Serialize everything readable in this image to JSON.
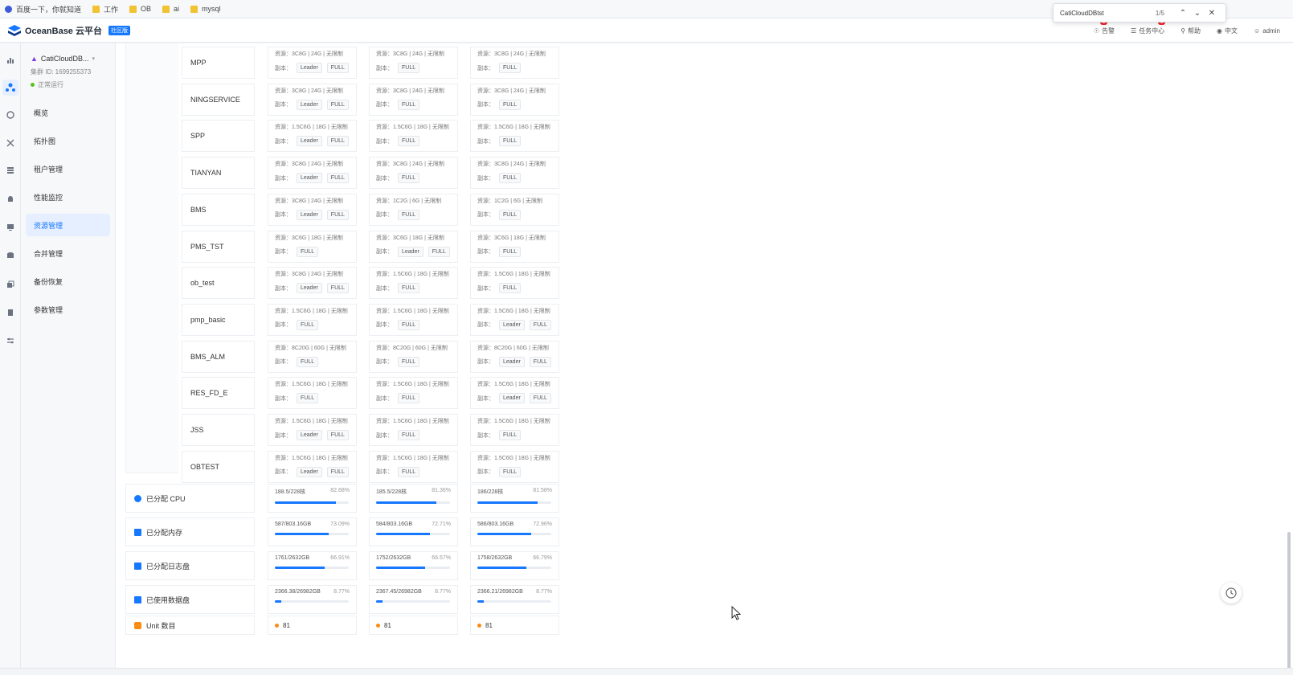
{
  "bookmarks": [
    "百度一下，你就知道",
    "工作",
    "OB",
    "ai",
    "mysql"
  ],
  "find": {
    "text": "CatiCloudDBtst",
    "count": "1/5"
  },
  "header": {
    "logo": "OceanBase 云平台",
    "badge": "社区版",
    "items": [
      {
        "label": "告警",
        "badge": "1"
      },
      {
        "label": "任务中心",
        "badge": "1"
      },
      {
        "label": "帮助"
      },
      {
        "label": "中文"
      },
      {
        "label": "admin"
      }
    ]
  },
  "cluster": {
    "name": "CatiCloudDB...",
    "id": "集群 ID: 1699255373",
    "status": "正常运行"
  },
  "menu": [
    "概览",
    "拓扑图",
    "租户管理",
    "性能监控",
    "资源管理",
    "合并管理",
    "备份恢复",
    "参数管理"
  ],
  "rows": [
    {
      "name": "MPP",
      "cells": [
        {
          "res": "资源：3C8G | 24G | 无限制",
          "reps": [
            "Leader",
            "FULL"
          ]
        },
        {
          "res": "资源：3C8G | 24G | 无限制",
          "reps": [
            "FULL"
          ]
        },
        {
          "res": "资源：3C8G | 24G | 无限制",
          "reps": [
            "FULL"
          ]
        }
      ]
    },
    {
      "name": "NINGSERVICE",
      "cells": [
        {
          "res": "资源：3C8G | 24G | 无限制",
          "reps": [
            "Leader",
            "FULL"
          ]
        },
        {
          "res": "资源：3C8G | 24G | 无限制",
          "reps": [
            "FULL"
          ]
        },
        {
          "res": "资源：3C8G | 24G | 无限制",
          "reps": [
            "FULL"
          ]
        }
      ]
    },
    {
      "name": "SPP",
      "cells": [
        {
          "res": "资源：1.5C6G | 18G | 无限制",
          "reps": [
            "Leader",
            "FULL"
          ]
        },
        {
          "res": "资源：1.5C6G | 18G | 无限制",
          "reps": [
            "FULL"
          ]
        },
        {
          "res": "资源：1.5C6G | 18G | 无限制",
          "reps": [
            "FULL"
          ]
        }
      ]
    },
    {
      "name": "TIANYAN",
      "cells": [
        {
          "res": "资源：3C8G | 24G | 无限制",
          "reps": [
            "Leader",
            "FULL"
          ]
        },
        {
          "res": "资源：3C8G | 24G | 无限制",
          "reps": [
            "FULL"
          ]
        },
        {
          "res": "资源：3C8G | 24G | 无限制",
          "reps": [
            "FULL"
          ]
        }
      ]
    },
    {
      "name": "BMS",
      "cells": [
        {
          "res": "资源：3C8G | 24G | 无限制",
          "reps": [
            "Leader",
            "FULL"
          ]
        },
        {
          "res": "资源：1C2G | 6G | 无限制",
          "reps": [
            "FULL"
          ]
        },
        {
          "res": "资源：1C2G | 6G | 无限制",
          "reps": [
            "FULL"
          ]
        }
      ]
    },
    {
      "name": "PMS_TST",
      "cells": [
        {
          "res": "资源：3C6G | 18G | 无限制",
          "reps": [
            "FULL"
          ]
        },
        {
          "res": "资源：3C6G | 18G | 无限制",
          "reps": [
            "Leader",
            "FULL"
          ]
        },
        {
          "res": "资源：3C6G | 18G | 无限制",
          "reps": [
            "FULL"
          ]
        }
      ]
    },
    {
      "name": "ob_test",
      "cells": [
        {
          "res": "资源：3C8G | 24G | 无限制",
          "reps": [
            "Leader",
            "FULL"
          ]
        },
        {
          "res": "资源：1.5C6G | 18G | 无限制",
          "reps": [
            "FULL"
          ]
        },
        {
          "res": "资源：1.5C6G | 18G | 无限制",
          "reps": [
            "FULL"
          ]
        }
      ]
    },
    {
      "name": "pmp_basic",
      "cells": [
        {
          "res": "资源：1.5C6G | 18G | 无限制",
          "reps": [
            "FULL"
          ]
        },
        {
          "res": "资源：1.5C6G | 18G | 无限制",
          "reps": [
            "FULL"
          ]
        },
        {
          "res": "资源：1.5C6G | 18G | 无限制",
          "reps": [
            "Leader",
            "FULL"
          ]
        }
      ]
    },
    {
      "name": "BMS_ALM",
      "cells": [
        {
          "res": "资源：8C20G | 60G | 无限制",
          "reps": [
            "FULL"
          ]
        },
        {
          "res": "资源：8C20G | 60G | 无限制",
          "reps": [
            "FULL"
          ]
        },
        {
          "res": "资源：8C20G | 60G | 无限制",
          "reps": [
            "Leader",
            "FULL"
          ]
        }
      ]
    },
    {
      "name": "RES_FD_E",
      "cells": [
        {
          "res": "资源：1.5C6G | 18G | 无限制",
          "reps": [
            "FULL"
          ]
        },
        {
          "res": "资源：1.5C6G | 18G | 无限制",
          "reps": [
            "FULL"
          ]
        },
        {
          "res": "资源：1.5C6G | 18G | 无限制",
          "reps": [
            "Leader",
            "FULL"
          ]
        }
      ]
    },
    {
      "name": "JSS",
      "cells": [
        {
          "res": "资源：1.5C6G | 18G | 无限制",
          "reps": [
            "Leader",
            "FULL"
          ]
        },
        {
          "res": "资源：1.5C6G | 18G | 无限制",
          "reps": [
            "FULL"
          ]
        },
        {
          "res": "资源：1.5C6G | 18G | 无限制",
          "reps": [
            "FULL"
          ]
        }
      ]
    },
    {
      "name": "OBTEST",
      "cells": [
        {
          "res": "资源：1.5C6G | 18G | 无限制",
          "reps": [
            "Leader",
            "FULL"
          ]
        },
        {
          "res": "资源：1.5C6G | 18G | 无限制",
          "reps": [
            "FULL"
          ]
        },
        {
          "res": "资源：1.5C6G | 18G | 无限制",
          "reps": [
            "FULL"
          ]
        }
      ]
    }
  ],
  "metrics": [
    {
      "label": "已分配 CPU",
      "icon": "cpu-icon",
      "cells": [
        {
          "value": "188.5/228核",
          "pct": "82.68%",
          "fill": 0.8268
        },
        {
          "value": "185.5/228核",
          "pct": "81.36%",
          "fill": 0.8136
        },
        {
          "value": "186/228核",
          "pct": "81.58%",
          "fill": 0.8158
        }
      ]
    },
    {
      "label": "已分配内存",
      "icon": "memory-icon",
      "cells": [
        {
          "value": "587/803.16GB",
          "pct": "73.09%",
          "fill": 0.7309
        },
        {
          "value": "584/803.16GB",
          "pct": "72.71%",
          "fill": 0.7271
        },
        {
          "value": "586/803.16GB",
          "pct": "72.96%",
          "fill": 0.7296
        }
      ]
    },
    {
      "label": "已分配日志盘",
      "icon": "log-disk-icon",
      "cells": [
        {
          "value": "1761/2632GB",
          "pct": "66.91%",
          "fill": 0.6691
        },
        {
          "value": "1752/2632GB",
          "pct": "66.57%",
          "fill": 0.6657
        },
        {
          "value": "1758/2632GB",
          "pct": "66.79%",
          "fill": 0.6679
        }
      ]
    },
    {
      "label": "已使用数据盘",
      "icon": "data-disk-icon",
      "cells": [
        {
          "value": "2366.38/26982GB",
          "pct": "8.77%",
          "fill": 0.0877
        },
        {
          "value": "2367.45/26982GB",
          "pct": "8.77%",
          "fill": 0.0877
        },
        {
          "value": "2366.21/26982GB",
          "pct": "8.77%",
          "fill": 0.0877
        }
      ]
    }
  ],
  "unit": {
    "label": "Unit 数目",
    "values": [
      "81",
      "81",
      "81"
    ]
  },
  "colors": {
    "primary": "#1677ff",
    "success": "#52c41a",
    "warning": "#fa8c16"
  }
}
